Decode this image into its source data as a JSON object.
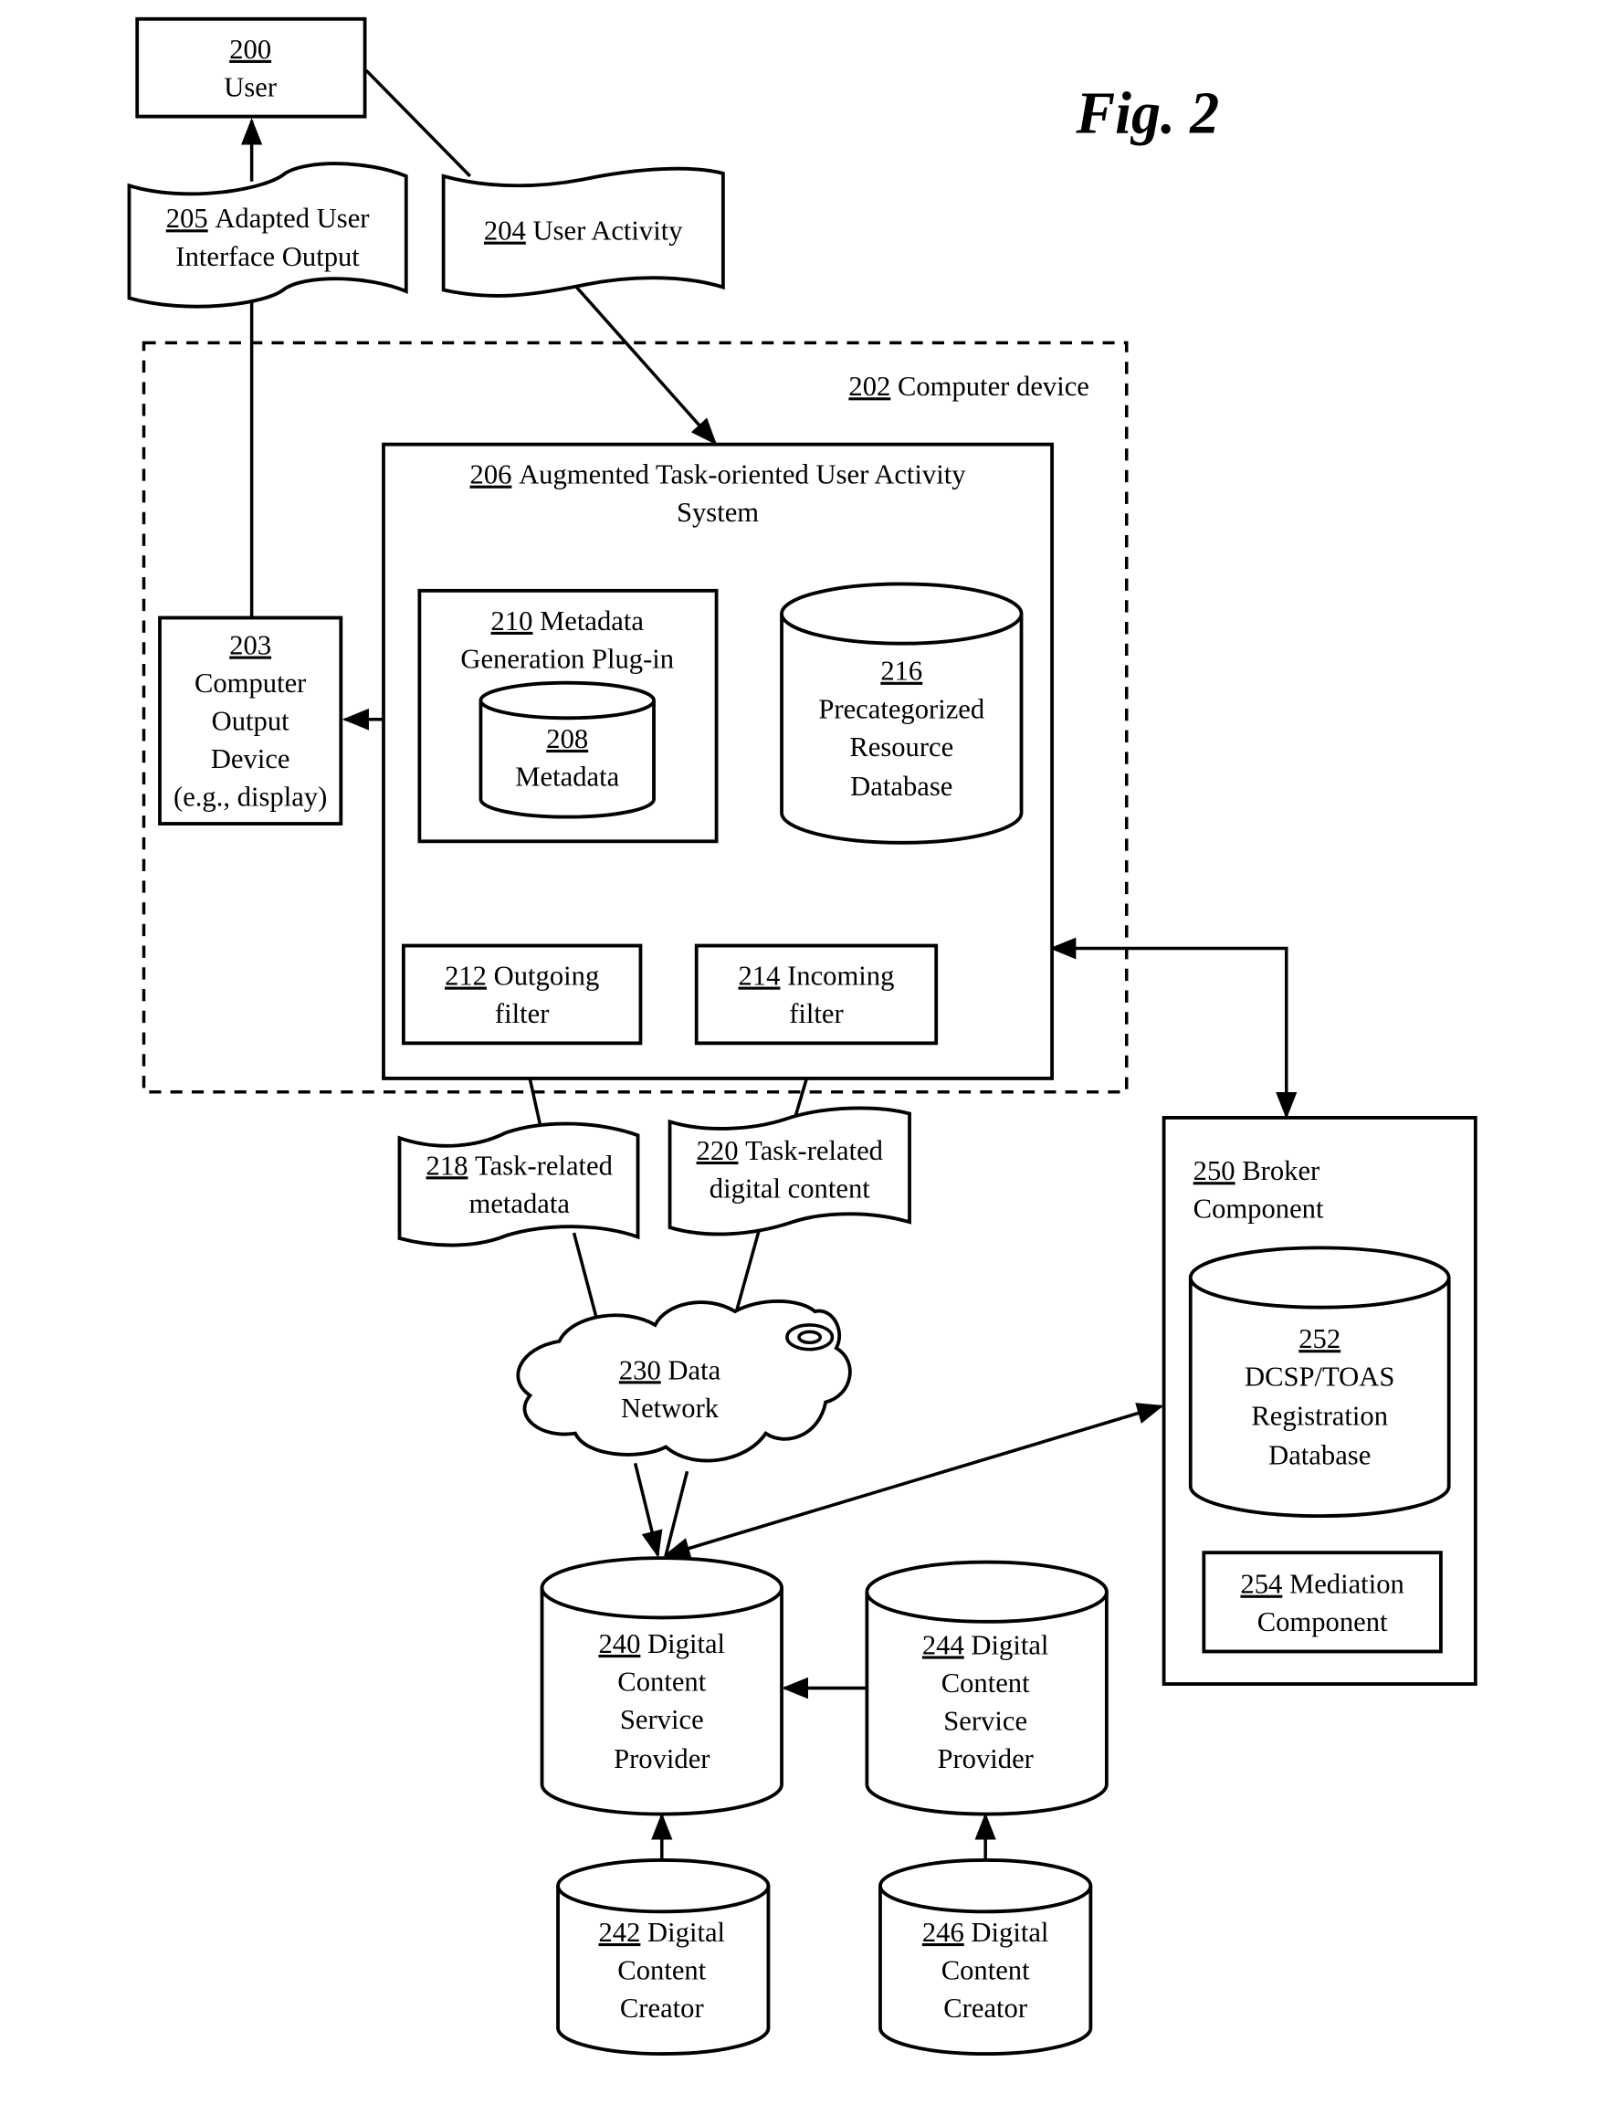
{
  "figure": {
    "label": "Fig. 2"
  },
  "nodes": {
    "user": {
      "num": "200",
      "lines": [
        "User"
      ]
    },
    "adapted_ui_output": {
      "num": "205",
      "line1": "Adapted User",
      "line2": "Interface Output"
    },
    "user_activity": {
      "num": "204",
      "line1": "User Activity"
    },
    "computer_device": {
      "num": "202",
      "label": "Computer device"
    },
    "augmented_system": {
      "num": "206",
      "line1": "Augmented Task-oriented User Activity",
      "line2": "System"
    },
    "computer_output_device": {
      "num": "203",
      "line1": "Computer",
      "line2": "Output",
      "line3": "Device",
      "line4": "(e.g., display)"
    },
    "metadata_plugin": {
      "num": "210",
      "line1": "Metadata",
      "line2": "Generation Plug-in"
    },
    "metadata": {
      "num": "208",
      "line1": "Metadata"
    },
    "precategorized_db": {
      "num": "216",
      "line1": "Precategorized",
      "line2": "Resource",
      "line3": "Database"
    },
    "outgoing_filter": {
      "num": "212",
      "line1": "Outgoing",
      "line2": "filter"
    },
    "incoming_filter": {
      "num": "214",
      "line1": "Incoming",
      "line2": "filter"
    },
    "task_metadata": {
      "num": "218",
      "line1": "Task-related",
      "line2": "metadata"
    },
    "task_content": {
      "num": "220",
      "line1": "Task-related",
      "line2": "digital content"
    },
    "data_network": {
      "num": "230",
      "line1": "Data",
      "line2": "Network"
    },
    "broker": {
      "num": "250",
      "line1": "Broker",
      "line2": "Component"
    },
    "registration_db": {
      "num": "252",
      "line1": "DCSP/TOAS",
      "line2": "Registration",
      "line3": "Database"
    },
    "mediation": {
      "num": "254",
      "line1": "Mediation",
      "line2": "Component"
    },
    "dcsp_240": {
      "num": "240",
      "line1": "Digital",
      "line2": "Content",
      "line3": "Service",
      "line4": "Provider"
    },
    "dcsp_244": {
      "num": "244",
      "line1": "Digital",
      "line2": "Content",
      "line3": "Service",
      "line4": "Provider"
    },
    "creator_242": {
      "num": "242",
      "line1": "Digital",
      "line2": "Content",
      "line3": "Creator"
    },
    "creator_246": {
      "num": "246",
      "line1": "Digital",
      "line2": "Content",
      "line3": "Creator"
    }
  }
}
